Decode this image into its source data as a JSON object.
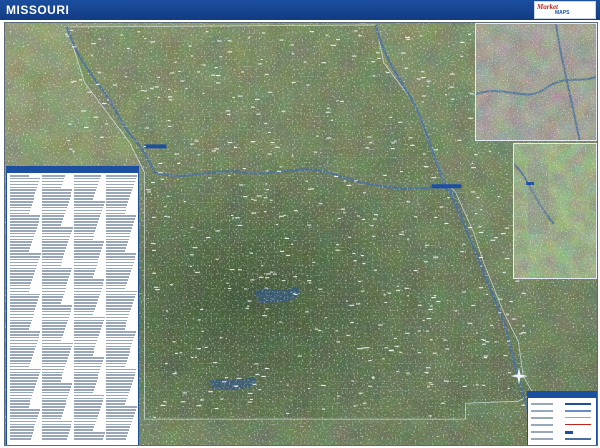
{
  "header": {
    "title": "MISSOURI",
    "logo_brand": "Market",
    "logo_sub": "MAPS"
  },
  "colors": {
    "header_blue": "#1c4fa0",
    "satellite_green": "#4e5e3a",
    "river_blue": "#4a6f9a",
    "boundary_white": "#e6ebf3",
    "legend_red": "#c0241c"
  },
  "icons": {
    "compass": "compass-rose-icon"
  }
}
